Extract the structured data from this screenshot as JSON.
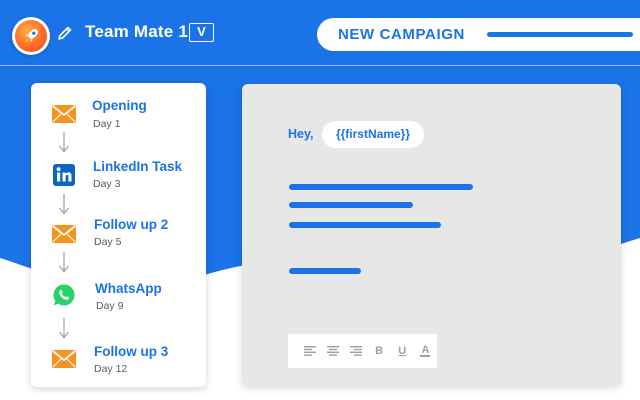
{
  "header": {
    "team_name": "Team Mate 1",
    "team_dropdown_label": "V",
    "campaign_button": "NEW CAMPAIGN"
  },
  "sequence": {
    "steps": [
      {
        "title": "Opening",
        "day": "Day 1",
        "icon": "envelope-icon"
      },
      {
        "title": "LinkedIn Task",
        "day": "Day 3",
        "icon": "linkedin-icon"
      },
      {
        "title": "Follow up 2",
        "day": "Day 5",
        "icon": "envelope-icon"
      },
      {
        "title": "WhatsApp",
        "day": "Day 9",
        "icon": "whatsapp-icon"
      },
      {
        "title": "Follow up 3",
        "day": "Day 12",
        "icon": "envelope-icon"
      }
    ]
  },
  "editor": {
    "greeting": "Hey,",
    "token": "{{firstName}}",
    "toolbar": [
      "align-left-icon",
      "align-center-icon",
      "align-right-icon",
      "B",
      "U",
      "A"
    ]
  },
  "colors": {
    "brand_blue": "#1b73e8",
    "envelope_orange": "#f7931e",
    "linkedin_blue": "#0a66c2",
    "whatsapp_green": "#25d366",
    "editor_bg": "#e7e7e7"
  }
}
